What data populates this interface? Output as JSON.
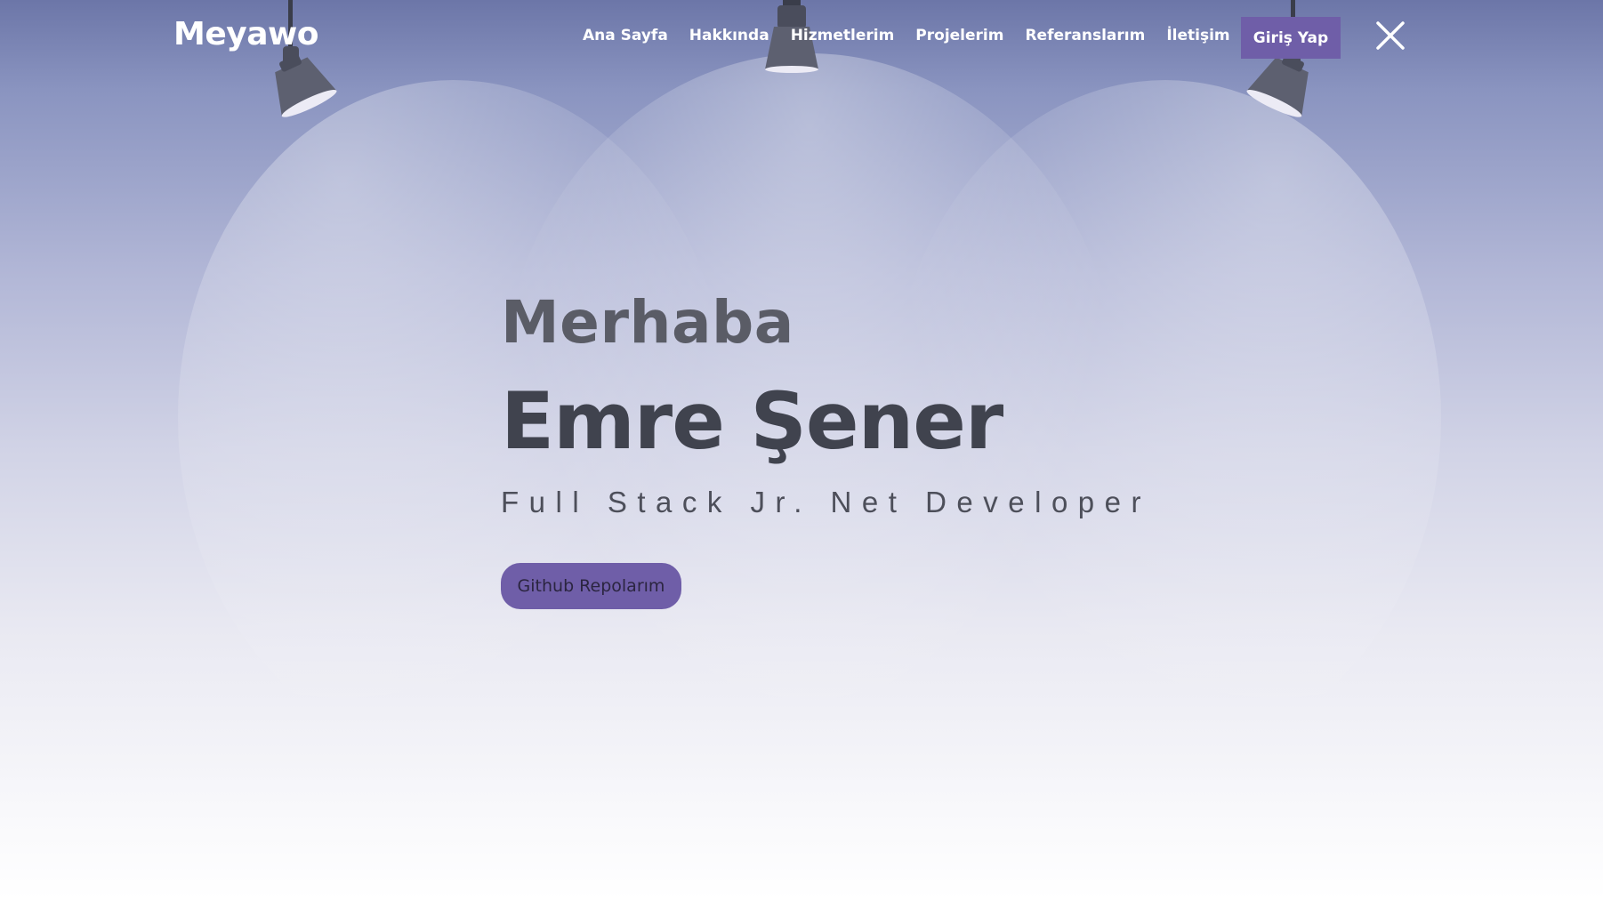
{
  "header": {
    "logo": "Meyawo",
    "nav": [
      {
        "label": "Ana Sayfa"
      },
      {
        "label": "Hakkında"
      },
      {
        "label": "Hizmetlerim"
      },
      {
        "label": "Projelerim"
      },
      {
        "label": "Referanslarım"
      },
      {
        "label": "İletişim"
      }
    ],
    "login_label": "Giriş Yap"
  },
  "hero": {
    "greeting": "Merhaba",
    "name": "Emre Şener",
    "role": "Full Stack Jr. Net Developer",
    "github_button": "Github Repolarım"
  },
  "icons": {
    "close": "close-icon",
    "lamp": "spotlight-lamp-icon"
  },
  "colors": {
    "accent": "#6f5ea8",
    "heading_dark": "#40434e",
    "heading_mid": "#5a5c66",
    "bg_top": "#6c76a8",
    "bg_bottom": "#ffffff"
  }
}
